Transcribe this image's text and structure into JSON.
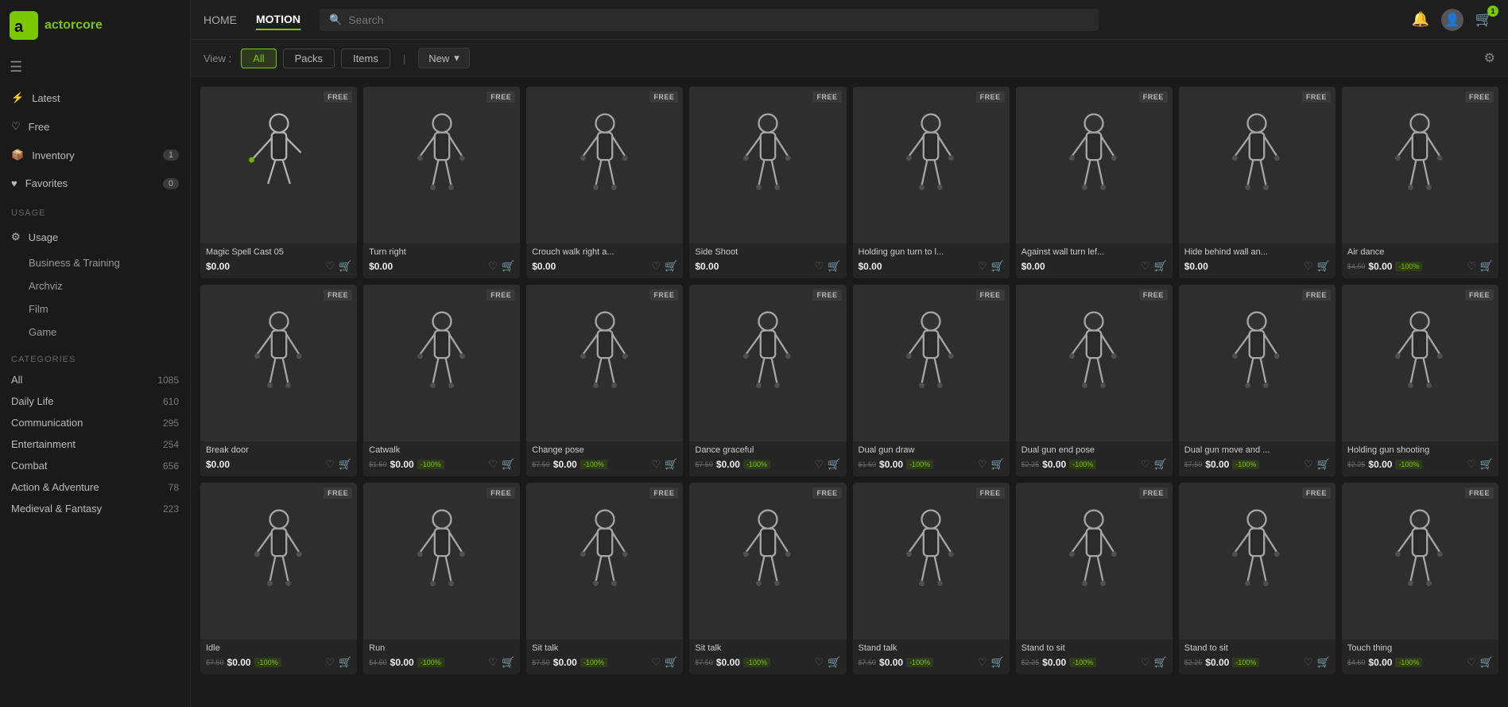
{
  "logo": {
    "text": "actorcore",
    "icon": "🎭"
  },
  "nav": {
    "items": [
      {
        "label": "HOME",
        "active": false
      },
      {
        "label": "MOTION",
        "active": true
      }
    ]
  },
  "search": {
    "placeholder": "Search"
  },
  "topbar_icons": {
    "notification": "🔔",
    "cart_count": "1",
    "settings": "⚙"
  },
  "sidebar": {
    "menu_sections": [
      {
        "items": [
          {
            "id": "latest",
            "label": "Latest",
            "icon": "⚡",
            "badge": null
          },
          {
            "id": "free",
            "label": "Free",
            "icon": "♡",
            "badge": null
          },
          {
            "id": "inventory",
            "label": "Inventory",
            "icon": "📦",
            "badge": "1"
          },
          {
            "id": "favorites",
            "label": "Favorites",
            "icon": "♥",
            "badge": "0"
          }
        ]
      },
      {
        "title": "Usage",
        "items": [
          {
            "label": "Business & Training"
          },
          {
            "label": "Archviz"
          },
          {
            "label": "Film"
          },
          {
            "label": "Game"
          }
        ]
      },
      {
        "title": "Categories",
        "items": [
          {
            "label": "All",
            "count": "1085"
          },
          {
            "label": "Daily Life",
            "count": "610"
          },
          {
            "label": "Communication",
            "count": "295"
          },
          {
            "label": "Entertainment",
            "count": "254"
          },
          {
            "label": "Combat",
            "count": "656"
          },
          {
            "label": "Action & Adventure",
            "count": "78"
          },
          {
            "label": "Medieval & Fantasy",
            "count": "223"
          }
        ]
      }
    ]
  },
  "filter": {
    "view_label": "View :",
    "buttons": [
      {
        "label": "All",
        "active": true
      },
      {
        "label": "Packs",
        "active": false
      },
      {
        "label": "Items",
        "active": false
      }
    ],
    "dropdown": {
      "label": "New",
      "icon": "▾"
    }
  },
  "cards": [
    {
      "title": "Magic Spell Cast 05",
      "price": "$0.00",
      "old_price": null,
      "discount": null,
      "free": true,
      "pose": "spell"
    },
    {
      "title": "Turn right",
      "price": "$0.00",
      "old_price": null,
      "discount": null,
      "free": true,
      "pose": "turn"
    },
    {
      "title": "Crouch walk right a...",
      "price": "$0.00",
      "old_price": null,
      "discount": null,
      "free": true,
      "pose": "crouch"
    },
    {
      "title": "Side Shoot",
      "price": "$0.00",
      "old_price": null,
      "discount": null,
      "free": true,
      "pose": "shoot"
    },
    {
      "title": "Holding gun turn to l...",
      "price": "$0.00",
      "old_price": null,
      "discount": null,
      "free": true,
      "pose": "gun_turn"
    },
    {
      "title": "Against wall turn lef...",
      "price": "$0.00",
      "old_price": null,
      "discount": null,
      "free": true,
      "pose": "wall"
    },
    {
      "title": "Hide behind wall an...",
      "price": "$0.00",
      "old_price": null,
      "discount": null,
      "free": true,
      "pose": "hide"
    },
    {
      "title": "Air dance",
      "price": "$0.00",
      "old_price": "$4.50",
      "discount": "-100%",
      "free": true,
      "pose": "dance_air"
    },
    {
      "title": "Break door",
      "price": "$0.00",
      "old_price": null,
      "discount": null,
      "free": true,
      "pose": "break"
    },
    {
      "title": "Catwalk",
      "price": "$0.00",
      "old_price": "$1.50",
      "discount": "-100%",
      "free": true,
      "pose": "catwalk"
    },
    {
      "title": "Change pose",
      "price": "$0.00",
      "old_price": "$7.50",
      "discount": "-100%",
      "free": true,
      "pose": "change"
    },
    {
      "title": "Dance graceful",
      "price": "$0.00",
      "old_price": "$7.50",
      "discount": "-100%",
      "free": true,
      "pose": "dance"
    },
    {
      "title": "Dual gun draw",
      "price": "$0.00",
      "old_price": "$1.50",
      "discount": "-100%",
      "free": true,
      "pose": "dual_draw"
    },
    {
      "title": "Dual gun end pose",
      "price": "$0.00",
      "old_price": "$2.25",
      "discount": "-100%",
      "free": true,
      "pose": "dual_end"
    },
    {
      "title": "Dual gun move and ...",
      "price": "$0.00",
      "old_price": "$7.50",
      "discount": "-100%",
      "free": true,
      "pose": "dual_move"
    },
    {
      "title": "Holding gun shooting",
      "price": "$0.00",
      "old_price": "$2.25",
      "discount": "-100%",
      "free": true,
      "pose": "gun_shoot"
    },
    {
      "title": "Idle",
      "price": "$0.00",
      "old_price": "$7.50",
      "discount": "-100%",
      "free": true,
      "pose": "idle"
    },
    {
      "title": "Run",
      "price": "$0.00",
      "old_price": "$4.50",
      "discount": "-100%",
      "free": true,
      "pose": "run"
    },
    {
      "title": "Sit talk",
      "price": "$0.00",
      "old_price": "$7.50",
      "discount": "-100%",
      "free": true,
      "pose": "sit_talk1"
    },
    {
      "title": "Sit talk",
      "price": "$0.00",
      "old_price": "$7.50",
      "discount": "-100%",
      "free": true,
      "pose": "sit_talk2"
    },
    {
      "title": "Stand talk",
      "price": "$0.00",
      "old_price": "$7.50",
      "discount": "-100%",
      "free": true,
      "pose": "stand_talk"
    },
    {
      "title": "Stand to sit",
      "price": "$0.00",
      "old_price": "$2.25",
      "discount": "-100%",
      "free": true,
      "pose": "stand_sit1"
    },
    {
      "title": "Stand to sit",
      "price": "$0.00",
      "old_price": "$2.25",
      "discount": "-100%",
      "free": true,
      "pose": "stand_sit2"
    },
    {
      "title": "Touch thing",
      "price": "$0.00",
      "old_price": "$4.50",
      "discount": "-100%",
      "free": true,
      "pose": "touch"
    }
  ]
}
